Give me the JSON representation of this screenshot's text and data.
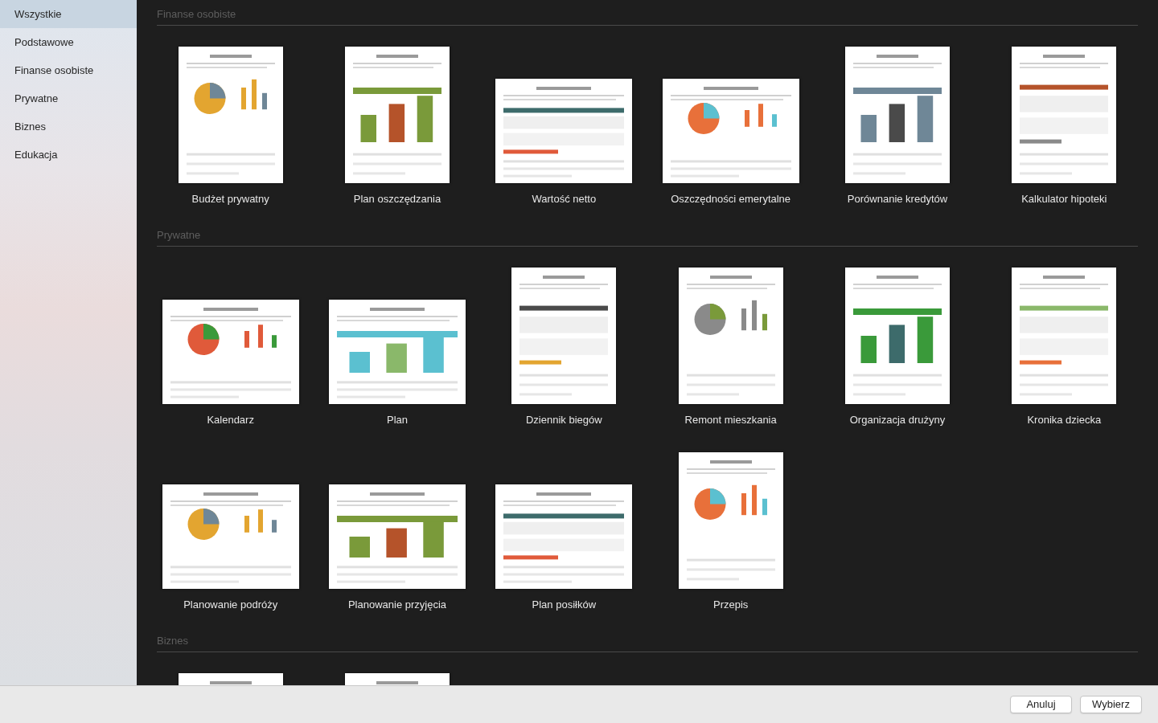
{
  "sidebar": {
    "items": [
      {
        "label": "Wszystkie",
        "selected": true
      },
      {
        "label": "Podstawowe",
        "selected": false
      },
      {
        "label": "Finanse osobiste",
        "selected": false
      },
      {
        "label": "Prywatne",
        "selected": false
      },
      {
        "label": "Biznes",
        "selected": false
      },
      {
        "label": "Edukacja",
        "selected": false
      }
    ]
  },
  "sections": [
    {
      "title": "Finanse osobiste",
      "templates": [
        {
          "label": "Budżet prywatny",
          "kind": "portrait"
        },
        {
          "label": "Plan oszczędzania",
          "kind": "portrait"
        },
        {
          "label": "Wartość netto",
          "kind": "landscape"
        },
        {
          "label": "Oszczędności emerytalne",
          "kind": "landscape"
        },
        {
          "label": "Porównanie kredytów",
          "kind": "portrait"
        },
        {
          "label": "Kalkulator hipoteki",
          "kind": "portrait"
        }
      ]
    },
    {
      "title": "Prywatne",
      "templates": [
        {
          "label": "Kalendarz",
          "kind": "landscape"
        },
        {
          "label": "Plan",
          "kind": "landscape"
        },
        {
          "label": "Dziennik biegów",
          "kind": "portrait"
        },
        {
          "label": "Remont mieszkania",
          "kind": "portrait"
        },
        {
          "label": "Organizacja drużyny",
          "kind": "portrait"
        },
        {
          "label": "Kronika dziecka",
          "kind": "portrait"
        },
        {
          "label": "Planowanie podróży",
          "kind": "landscape"
        },
        {
          "label": "Planowanie przyjęcia",
          "kind": "landscape"
        },
        {
          "label": "Plan posiłków",
          "kind": "landscape"
        },
        {
          "label": "Przepis",
          "kind": "portrait"
        }
      ]
    },
    {
      "title": "Biznes",
      "templates": [
        {
          "kind": "portrait"
        },
        {
          "kind": "portrait"
        }
      ]
    }
  ],
  "footer": {
    "buttons": [
      "Anuluj",
      "Wybierz"
    ]
  }
}
